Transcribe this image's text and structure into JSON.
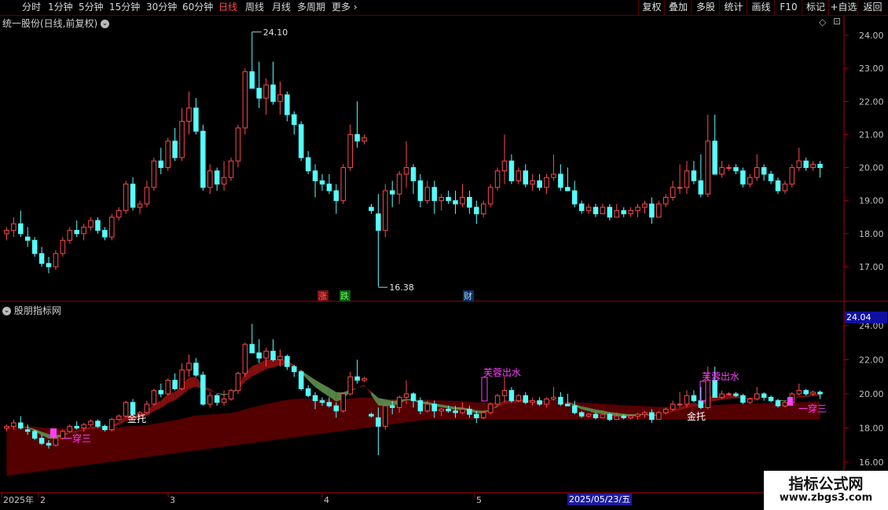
{
  "toolbar": {
    "periods": [
      "分时",
      "1分钟",
      "5分钟",
      "15分钟",
      "30分钟",
      "60分钟",
      "日线",
      "周线",
      "月线",
      "多周期",
      "更多"
    ],
    "active": "日线",
    "right": [
      "复权",
      "叠加",
      "多股",
      "统计",
      "画线",
      "F10",
      "标记",
      "+自选",
      "返回"
    ]
  },
  "main": {
    "title": "统一股份(日线,前复权)",
    "high_label": "24.10",
    "low_label": "16.38",
    "axis": [
      "24.00",
      "23.00",
      "22.00",
      "21.00",
      "20.00",
      "19.00",
      "18.00",
      "17.00"
    ],
    "markers": [
      {
        "text": "涨",
        "bg": "#7a0f0f",
        "color": "#ff6060"
      },
      {
        "text": "跌",
        "bg": "#0f5a0f",
        "color": "#60ff60"
      },
      {
        "text": "财",
        "bg": "#10305a",
        "color": "#9fd4ff"
      }
    ]
  },
  "indicator": {
    "title": "股朋指标网",
    "price_badge": "24.04",
    "axis": [
      "24.00",
      "22.00",
      "20.00",
      "18.00",
      "16.00"
    ],
    "signals": [
      "芙蓉出水",
      "芙蓉出水",
      "一穿三",
      "一穿三",
      "金托",
      "金托"
    ]
  },
  "xaxis": {
    "labels": [
      "2025年",
      "2",
      "3",
      "4",
      "5",
      "2025/05/23/五"
    ]
  },
  "watermark": {
    "line1": "指标公式网",
    "line2": "www.zbgs3.com"
  },
  "colors": {
    "up": "#ff4a4a",
    "down": "#54ffff",
    "axis": "#b00000",
    "band_red": "#5a0000",
    "band_red2": "#8a1010",
    "band_green": "#5a8a4a"
  },
  "chart_data": {
    "type": "candlestick",
    "ylim_main": [
      16.3,
      24.4
    ],
    "ylim_indicator": [
      15.5,
      24.5
    ],
    "candles": [
      [
        18.0,
        18.2,
        17.8,
        18.1
      ],
      [
        18.1,
        18.5,
        17.9,
        18.3
      ],
      [
        18.3,
        18.7,
        17.9,
        18.0
      ],
      [
        17.9,
        18.2,
        17.6,
        17.8
      ],
      [
        17.8,
        17.9,
        17.3,
        17.4
      ],
      [
        17.4,
        17.6,
        17.0,
        17.1
      ],
      [
        17.1,
        17.3,
        16.8,
        17.0
      ],
      [
        17.0,
        17.5,
        16.9,
        17.4
      ],
      [
        17.4,
        17.9,
        17.3,
        17.8
      ],
      [
        17.8,
        18.2,
        17.7,
        18.1
      ],
      [
        18.1,
        18.4,
        17.9,
        18.0
      ],
      [
        18.0,
        18.3,
        17.8,
        18.2
      ],
      [
        18.2,
        18.5,
        18.1,
        18.4
      ],
      [
        18.4,
        18.5,
        18.0,
        18.1
      ],
      [
        18.1,
        18.2,
        17.8,
        17.9
      ],
      [
        17.9,
        18.6,
        17.8,
        18.5
      ],
      [
        18.5,
        18.8,
        18.4,
        18.7
      ],
      [
        18.7,
        19.6,
        18.6,
        19.5
      ],
      [
        19.5,
        19.7,
        18.7,
        18.8
      ],
      [
        18.8,
        19.0,
        18.6,
        18.9
      ],
      [
        18.9,
        19.6,
        18.8,
        19.4
      ],
      [
        19.4,
        20.3,
        19.3,
        20.2
      ],
      [
        20.2,
        20.6,
        19.8,
        20.0
      ],
      [
        20.0,
        20.9,
        19.9,
        20.8
      ],
      [
        20.8,
        21.2,
        20.2,
        20.3
      ],
      [
        20.3,
        21.8,
        20.2,
        21.4
      ],
      [
        21.4,
        22.3,
        21.0,
        21.8
      ],
      [
        21.8,
        22.1,
        21.0,
        21.1
      ],
      [
        21.1,
        21.3,
        19.3,
        19.4
      ],
      [
        19.4,
        20.1,
        19.2,
        19.9
      ],
      [
        19.9,
        20.0,
        19.3,
        19.5
      ],
      [
        19.5,
        20.2,
        19.3,
        19.7
      ],
      [
        19.7,
        20.3,
        19.6,
        20.2
      ],
      [
        20.2,
        21.3,
        20.0,
        21.2
      ],
      [
        21.2,
        23.0,
        21.0,
        22.9
      ],
      [
        22.9,
        24.1,
        22.4,
        22.4
      ],
      [
        22.4,
        23.2,
        21.8,
        22.1
      ],
      [
        22.1,
        22.7,
        21.6,
        22.5
      ],
      [
        22.5,
        23.2,
        21.9,
        22.0
      ],
      [
        22.0,
        22.6,
        21.6,
        22.2
      ],
      [
        22.2,
        22.3,
        21.4,
        21.6
      ],
      [
        21.6,
        21.7,
        21.0,
        21.3
      ],
      [
        21.3,
        21.4,
        20.2,
        20.3
      ],
      [
        20.3,
        20.5,
        19.8,
        19.9
      ],
      [
        19.9,
        20.1,
        19.1,
        19.6
      ],
      [
        19.6,
        19.8,
        19.3,
        19.5
      ],
      [
        19.5,
        19.8,
        19.2,
        19.3
      ],
      [
        19.3,
        19.5,
        18.6,
        19.0
      ],
      [
        19.0,
        20.1,
        18.9,
        20.0
      ],
      [
        20.0,
        21.3,
        19.9,
        21.0
      ],
      [
        21.0,
        22.0,
        20.6,
        20.8
      ],
      [
        20.8,
        21.0,
        20.7,
        20.9
      ],
      [
        18.8,
        18.9,
        18.6,
        18.7
      ],
      [
        18.6,
        19.2,
        16.4,
        18.1
      ],
      [
        18.1,
        19.5,
        17.9,
        19.3
      ],
      [
        19.3,
        19.6,
        18.8,
        19.2
      ],
      [
        19.2,
        19.9,
        18.9,
        19.8
      ],
      [
        19.8,
        20.8,
        19.4,
        20.0
      ],
      [
        20.0,
        20.1,
        19.2,
        19.6
      ],
      [
        19.6,
        19.8,
        18.8,
        19.0
      ],
      [
        19.0,
        19.6,
        18.9,
        19.4
      ],
      [
        19.4,
        19.6,
        18.6,
        19.0
      ],
      [
        19.0,
        19.2,
        18.7,
        19.1
      ],
      [
        19.1,
        19.3,
        18.9,
        19.0
      ],
      [
        19.0,
        19.3,
        18.6,
        18.9
      ],
      [
        18.9,
        19.5,
        18.8,
        19.1
      ],
      [
        19.1,
        19.3,
        18.6,
        18.8
      ],
      [
        18.8,
        19.0,
        18.3,
        18.6
      ],
      [
        18.6,
        19.0,
        18.5,
        18.9
      ],
      [
        18.9,
        19.5,
        18.8,
        19.4
      ],
      [
        19.4,
        20.0,
        19.3,
        19.9
      ],
      [
        19.9,
        21.0,
        19.5,
        20.2
      ],
      [
        20.2,
        20.4,
        19.5,
        19.6
      ],
      [
        19.6,
        20.0,
        19.5,
        19.9
      ],
      [
        19.9,
        20.1,
        19.4,
        19.5
      ],
      [
        19.5,
        19.8,
        19.3,
        19.6
      ],
      [
        19.6,
        19.8,
        19.3,
        19.4
      ],
      [
        19.4,
        19.8,
        19.2,
        19.7
      ],
      [
        19.7,
        20.4,
        19.6,
        19.8
      ],
      [
        19.8,
        20.1,
        19.3,
        19.4
      ],
      [
        19.4,
        20.0,
        19.3,
        19.3
      ],
      [
        19.3,
        19.6,
        18.8,
        18.9
      ],
      [
        18.9,
        19.0,
        18.6,
        18.7
      ],
      [
        18.7,
        18.9,
        18.6,
        18.8
      ],
      [
        18.8,
        18.9,
        18.5,
        18.6
      ],
      [
        18.6,
        18.9,
        18.6,
        18.8
      ],
      [
        18.8,
        18.9,
        18.4,
        18.5
      ],
      [
        18.5,
        18.9,
        18.5,
        18.7
      ],
      [
        18.7,
        18.8,
        18.5,
        18.6
      ],
      [
        18.6,
        18.8,
        18.5,
        18.7
      ],
      [
        18.7,
        18.9,
        18.5,
        18.8
      ],
      [
        18.8,
        19.0,
        18.6,
        18.9
      ],
      [
        18.9,
        19.1,
        18.3,
        18.5
      ],
      [
        18.5,
        19.0,
        18.5,
        18.9
      ],
      [
        18.9,
        19.2,
        18.8,
        19.1
      ],
      [
        19.1,
        19.6,
        19.0,
        19.4
      ],
      [
        19.4,
        20.1,
        19.2,
        19.4
      ],
      [
        19.4,
        20.2,
        19.2,
        19.9
      ],
      [
        19.9,
        20.2,
        19.5,
        19.6
      ],
      [
        19.6,
        20.4,
        19.1,
        19.2
      ],
      [
        19.2,
        21.6,
        19.1,
        20.8
      ],
      [
        20.8,
        21.6,
        19.9,
        19.8
      ],
      [
        19.8,
        20.2,
        19.7,
        20.0
      ],
      [
        20.0,
        20.1,
        19.9,
        20.0
      ],
      [
        20.0,
        20.1,
        19.8,
        19.9
      ],
      [
        19.9,
        20.0,
        19.4,
        19.5
      ],
      [
        19.5,
        19.8,
        19.4,
        19.7
      ],
      [
        19.7,
        20.4,
        19.6,
        20.0
      ],
      [
        20.0,
        20.1,
        19.6,
        19.8
      ],
      [
        19.8,
        19.9,
        19.5,
        19.6
      ],
      [
        19.6,
        19.7,
        19.2,
        19.3
      ],
      [
        19.3,
        19.6,
        19.2,
        19.5
      ],
      [
        19.5,
        20.1,
        19.4,
        20.0
      ],
      [
        20.0,
        20.6,
        19.9,
        20.2
      ],
      [
        20.2,
        20.3,
        19.9,
        20.0
      ],
      [
        20.0,
        20.2,
        19.9,
        20.1
      ],
      [
        20.1,
        20.2,
        19.7,
        20.0
      ]
    ]
  }
}
